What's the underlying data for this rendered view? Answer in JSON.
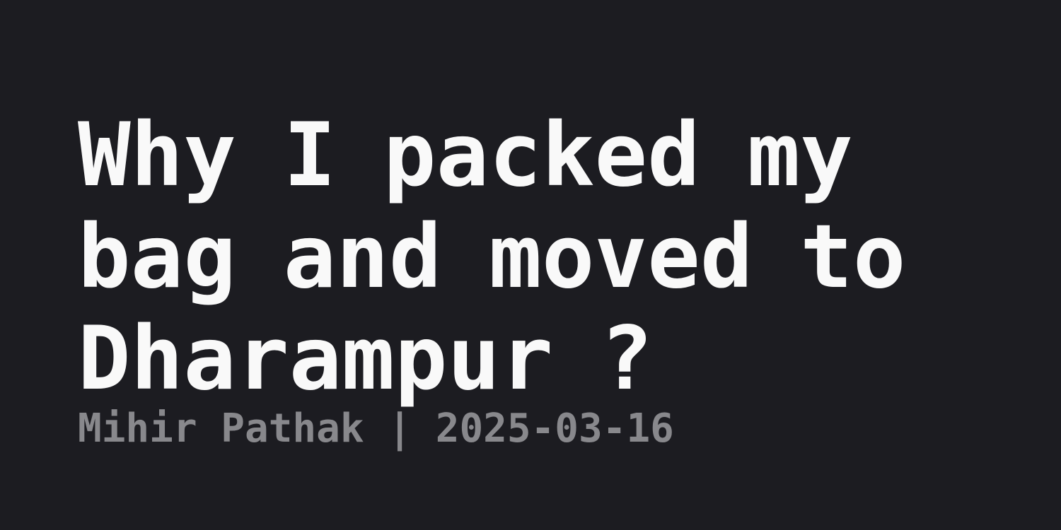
{
  "post": {
    "title": "Why I packed my bag and moved to Dharampur ?",
    "author": "Mihir Pathak",
    "separator": "|",
    "date": "2025-03-16"
  },
  "colors": {
    "background": "#1c1c21",
    "title": "#f9f9f9",
    "meta": "#88888c"
  }
}
